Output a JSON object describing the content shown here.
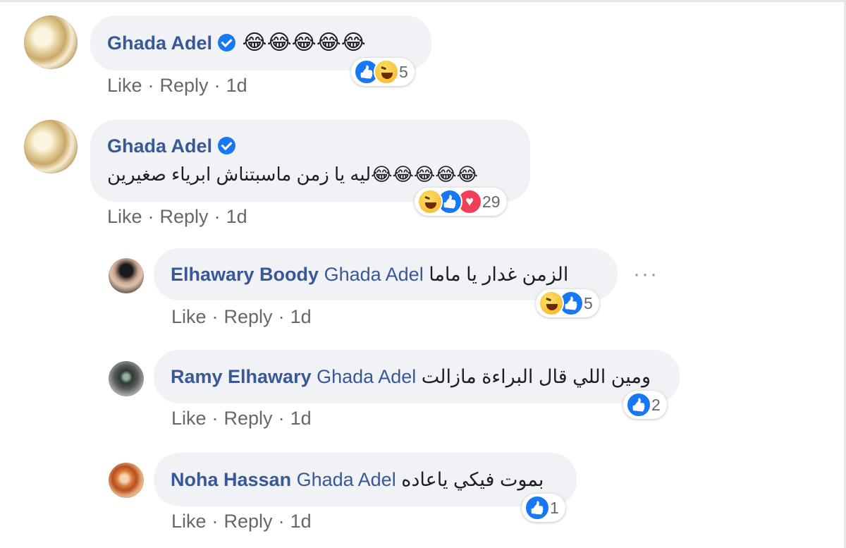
{
  "actions": {
    "like": "Like",
    "reply": "Reply",
    "dot": "·"
  },
  "icons": {
    "verified": "verified-badge-icon",
    "more": "more-options-icon",
    "like": "like-reaction-icon",
    "haha": "haha-reaction-icon",
    "love": "love-reaction-icon"
  },
  "colors": {
    "name": "#385898",
    "bubble": "#f0f2f5",
    "meta": "#65676b",
    "like_blue": "#1877f2"
  },
  "comments": [
    {
      "author": "Ghada Adel",
      "verified": true,
      "text": "😂😂😂😂😂",
      "time": "1d",
      "reaction_count": "5"
    },
    {
      "author": "Ghada Adel",
      "verified": true,
      "text": "ليه يا زمن ماسبتناش ابرياء صغيرين😂😂😂😂😂",
      "time": "1d",
      "reaction_count": "29"
    }
  ],
  "replies": [
    {
      "author": "Elhawary Boody",
      "tag": "Ghada Adel",
      "text": "الزمن غدار يا ماما",
      "time": "1d",
      "reaction_count": "5",
      "more": "···"
    },
    {
      "author": "Ramy Elhawary",
      "tag": "Ghada Adel",
      "text": "ومين اللي قال البراءة مازالت",
      "time": "1d",
      "reaction_count": "2"
    },
    {
      "author": "Noha Hassan",
      "tag": "Ghada Adel",
      "text": "بموت فيكي ياعاده",
      "time": "1d",
      "reaction_count": "1"
    }
  ]
}
